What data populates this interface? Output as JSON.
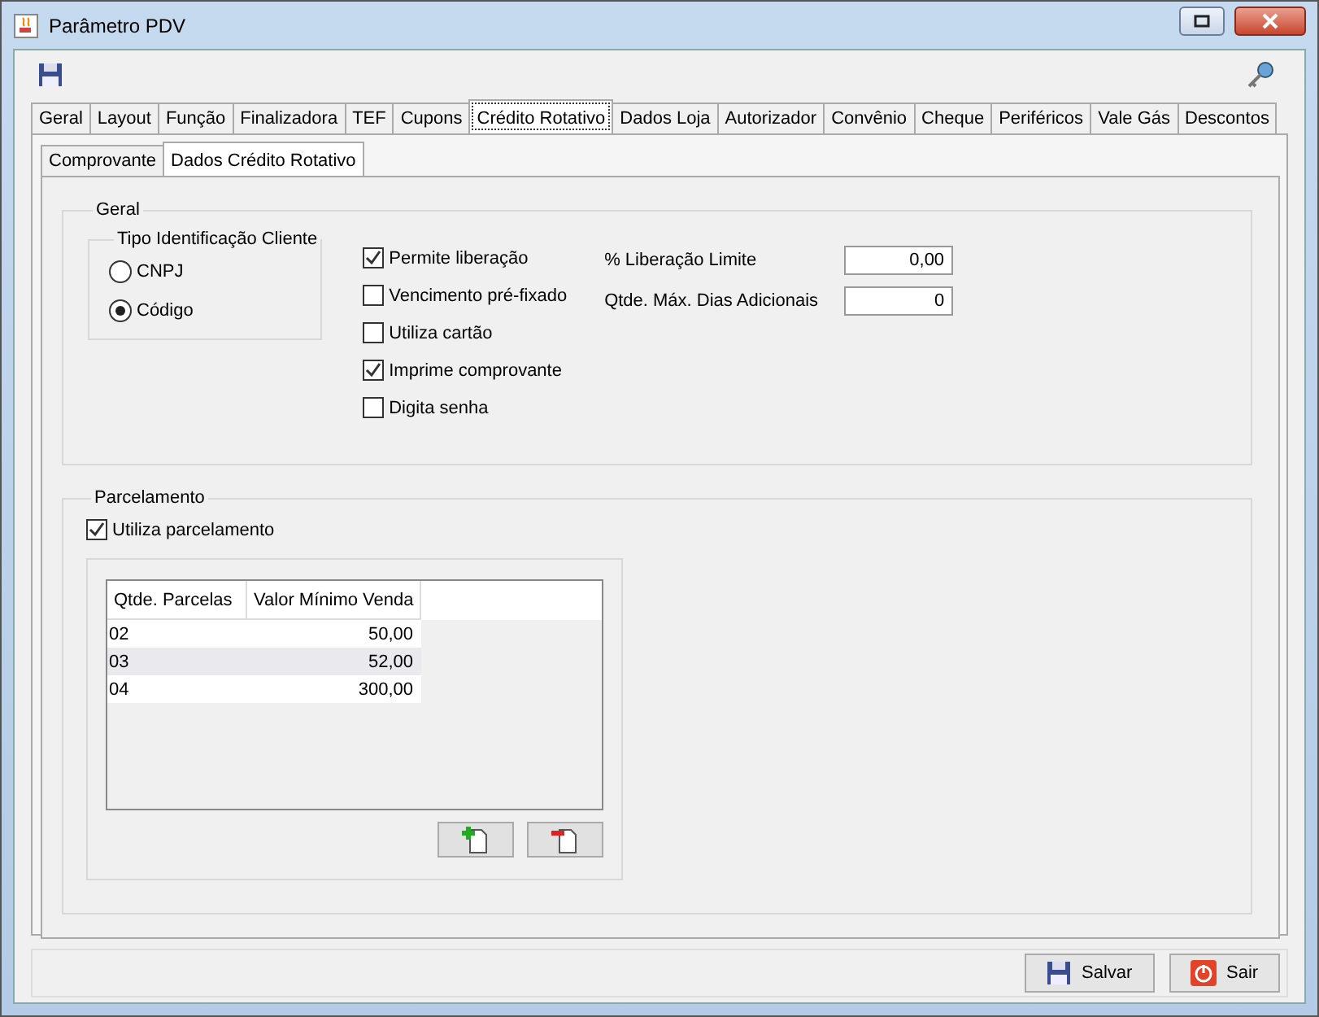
{
  "window": {
    "title": "Parâmetro PDV"
  },
  "tabs": [
    {
      "label": "Geral",
      "selected": false
    },
    {
      "label": "Layout",
      "selected": false
    },
    {
      "label": "Função",
      "selected": false
    },
    {
      "label": "Finalizadora",
      "selected": false
    },
    {
      "label": "TEF",
      "selected": false
    },
    {
      "label": "Cupons",
      "selected": false
    },
    {
      "label": "Crédito Rotativo",
      "selected": true
    },
    {
      "label": "Dados Loja",
      "selected": false
    },
    {
      "label": "Autorizador",
      "selected": false
    },
    {
      "label": "Convênio",
      "selected": false
    },
    {
      "label": "Cheque",
      "selected": false
    },
    {
      "label": "Periféricos",
      "selected": false
    },
    {
      "label": "Vale Gás",
      "selected": false
    },
    {
      "label": "Descontos",
      "selected": false
    }
  ],
  "inner_tabs": [
    {
      "label": "Comprovante",
      "selected": false
    },
    {
      "label": "Dados Crédito Rotativo",
      "selected": true
    }
  ],
  "geral": {
    "legend": "Geral",
    "tipo_identificacao": {
      "legend": "Tipo Identificação Cliente",
      "options": [
        {
          "label": "CNPJ",
          "selected": false
        },
        {
          "label": "Código",
          "selected": true
        }
      ]
    },
    "checkboxes": [
      {
        "label": "Permite liberação",
        "checked": true
      },
      {
        "label": "Vencimento pré-fixado",
        "checked": false
      },
      {
        "label": "Utiliza cartão",
        "checked": false
      },
      {
        "label": "Imprime comprovante",
        "checked": true
      },
      {
        "label": "Digita senha",
        "checked": false
      }
    ],
    "fields": [
      {
        "label": "% Liberação Limite",
        "value": "0,00"
      },
      {
        "label": "Qtde. Máx. Dias Adicionais",
        "value": "0"
      }
    ]
  },
  "parcelamento": {
    "legend": "Parcelamento",
    "checkbox": {
      "label": "Utiliza parcelamento",
      "checked": true
    },
    "table": {
      "columns": [
        "Qtde. Parcelas",
        "Valor Mínimo Venda"
      ],
      "rows": [
        [
          "02",
          "50,00"
        ],
        [
          "03",
          "52,00"
        ],
        [
          "04",
          "300,00"
        ]
      ]
    }
  },
  "buttons": [
    {
      "label": "Salvar",
      "kind": "save"
    },
    {
      "label": "Sair",
      "kind": "exit"
    }
  ]
}
